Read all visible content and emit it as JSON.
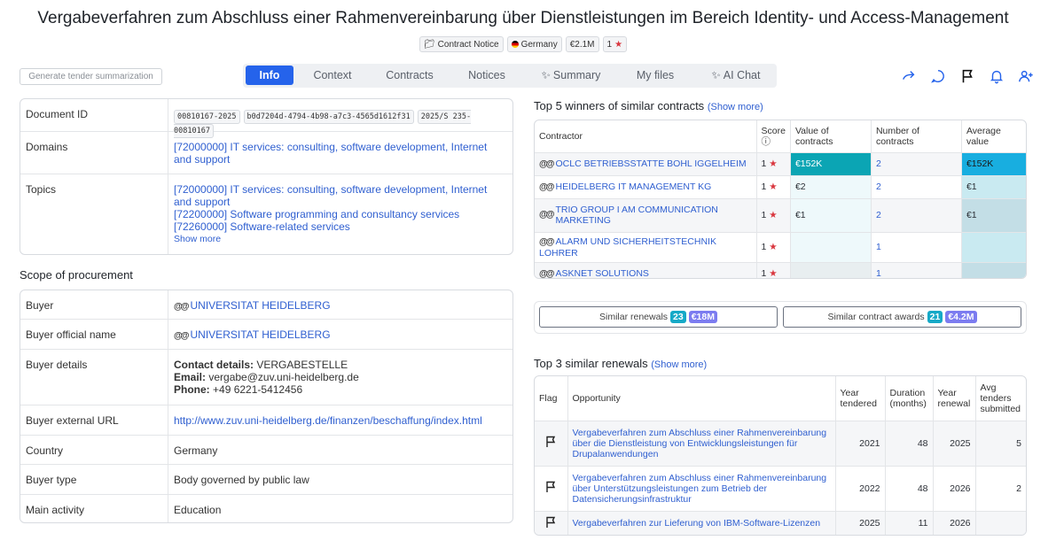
{
  "title": "Vergabeverfahren zum Abschluss einer Rahmenvereinbarung über Dienstleistungen im Bereich Identity- und Access-Management",
  "meta": {
    "type": "Contract Notice",
    "country": "Germany",
    "value": "€2.1M",
    "score": "1"
  },
  "generate_btn": "Generate tender summarization",
  "tabs": [
    "Info",
    "Context",
    "Contracts",
    "Notices",
    "Summary",
    "My files",
    "AI Chat"
  ],
  "info": {
    "document_id_label": "Document ID",
    "document_ids": [
      "00810167-2025",
      "b0d7204d-4794-4b98-a7c3-4565d1612f31",
      "2025/S 235-00810167"
    ],
    "domains_label": "Domains",
    "domains_value": "[72000000] IT services: consulting, software development, Internet and support",
    "topics_label": "Topics",
    "topics": [
      "[72000000] IT services: consulting, software development, Internet and support",
      "[72200000] Software programming and consultancy services",
      "[72260000] Software-related services"
    ],
    "show_more": "Show more"
  },
  "scope": {
    "heading": "Scope of procurement",
    "buyer_label": "Buyer",
    "buyer": "UNIVERSITAT HEIDELBERG",
    "official_label": "Buyer official name",
    "official": "UNIVERSITAT HEIDELBERG",
    "details_label": "Buyer details",
    "contact_key": "Contact details:",
    "contact_val": "VERGABESTELLE",
    "email_key": "Email:",
    "email_val": "vergabe@zuv.uni-heidelberg.de",
    "phone_key": "Phone:",
    "phone_val": "+49 6221-5412456",
    "url_label": "Buyer external URL",
    "url": "http://www.zuv.uni-heidelberg.de/finanzen/beschaffung/index.html",
    "country_label": "Country",
    "country": "Germany",
    "type_label": "Buyer type",
    "type": "Body governed by public law",
    "activity_label": "Main activity",
    "activity": "Education"
  },
  "winners": {
    "heading": "Top 5 winners of similar contracts",
    "show_more": "Show more",
    "headers": [
      "Contractor",
      "Score",
      "Value of contracts",
      "Number of contracts",
      "Average value"
    ],
    "rows": [
      {
        "name": "OCLC BETRIEBSSTATTE BOHL IGGELHEIM",
        "score": "1",
        "value": "€152K",
        "count": "2",
        "avg": "€152K"
      },
      {
        "name": "HEIDELBERG IT MANAGEMENT KG",
        "score": "1",
        "value": "€2",
        "count": "2",
        "avg": "€1"
      },
      {
        "name": "TRIO GROUP I AM COMMUNICATION MARKETING",
        "score": "1",
        "value": "€1",
        "count": "2",
        "avg": "€1"
      },
      {
        "name": "ALARM UND SICHERHEITSTECHNIK LOHRER",
        "score": "1",
        "value": "",
        "count": "1",
        "avg": ""
      },
      {
        "name": "ASKNET SOLUTIONS",
        "score": "1",
        "value": "",
        "count": "1",
        "avg": ""
      }
    ]
  },
  "similar": {
    "renewals_label": "Similar renewals",
    "renewals_count": "23",
    "renewals_value": "€18M",
    "awards_label": "Similar contract awards",
    "awards_count": "21",
    "awards_value": "€4.2M"
  },
  "renewals": {
    "heading": "Top 3 similar renewals",
    "show_more": "Show more",
    "headers": [
      "Flag",
      "Opportunity",
      "Year tendered",
      "Duration (months)",
      "Year renewal",
      "Avg tenders submitted"
    ],
    "rows": [
      {
        "opp": "Vergabeverfahren zum Abschluss einer Rahmenvereinbarung über die Dienstleistung von Entwicklungsleistungen für Drupalanwendungen",
        "year": "2021",
        "dur": "48",
        "renew": "2025",
        "avg": "5"
      },
      {
        "opp": "Vergabeverfahren zum Abschluss einer Rahmenvereinbarung über Unterstützungsleistungen zum Betrieb der Datensicherungsinfrastruktur",
        "year": "2022",
        "dur": "48",
        "renew": "2026",
        "avg": "2"
      },
      {
        "opp": "Vergabeverfahren zur Lieferung von IBM-Software-Lizenzen",
        "year": "2025",
        "dur": "11",
        "renew": "2026",
        "avg": ""
      }
    ]
  }
}
